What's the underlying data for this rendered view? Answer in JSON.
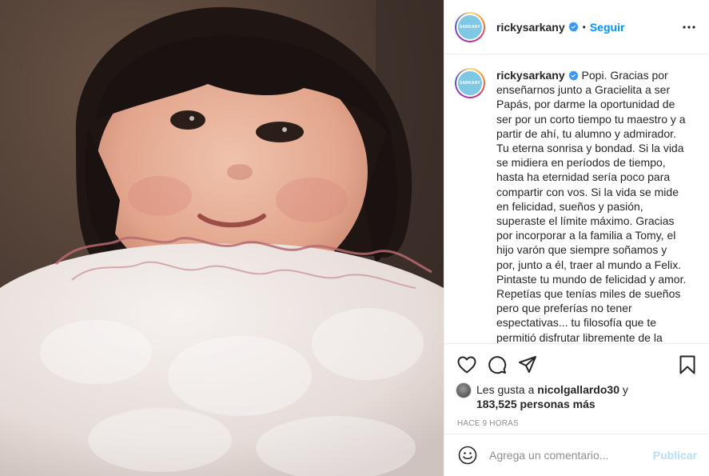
{
  "post": {
    "photo_icon": "photo-of-child",
    "username": "rickysarkany",
    "avatar_text": "SARKANY",
    "separator": "•",
    "follow_label": "Seguir",
    "more_icon": "more-horizontal-icon"
  },
  "caption": {
    "username": "rickysarkany",
    "text": "Popi. Gracias por enseñarnos junto a Gracielita a ser Papás, por darme la oportunidad de ser por un corto tiempo tu maestro y a partir de ahí, tu alumno y admirador. Tu eterna sonrisa y bondad. Si la vida se midiera en períodos de tiempo, hasta ha eternidad sería poco para compartir con vos. Si la vida se mide en felicidad, sueños y pasión, superaste el límite máximo. Gracias por incorporar a la familia a Tomy, el hijo varón que siempre soñamos y por, junto a él, traer al mundo a Felix. Pintaste tu mundo de felicidad y amor. Repetías que tenías miles de sueños pero que preferías no tener espectativas... tu filosofía que te permitió disfrutar libremente de la"
  },
  "actions": {
    "icons": [
      "heart-icon",
      "comment-icon",
      "share-icon",
      "bookmark-icon"
    ]
  },
  "likes": {
    "prefix": "Les gusta a ",
    "user": "nicolgallardo30",
    "joiner": " y",
    "count": "183,525 personas más"
  },
  "timestamp": "HACE 9 HORAS",
  "add_comment": {
    "placeholder": "Agrega un comentario...",
    "publish_label": "Publicar"
  },
  "colors": {
    "accent": "#0095f6",
    "publish_disabled": "#b2dffc",
    "text": "#262626",
    "muted": "#8e8e8e",
    "border": "#efefef"
  }
}
